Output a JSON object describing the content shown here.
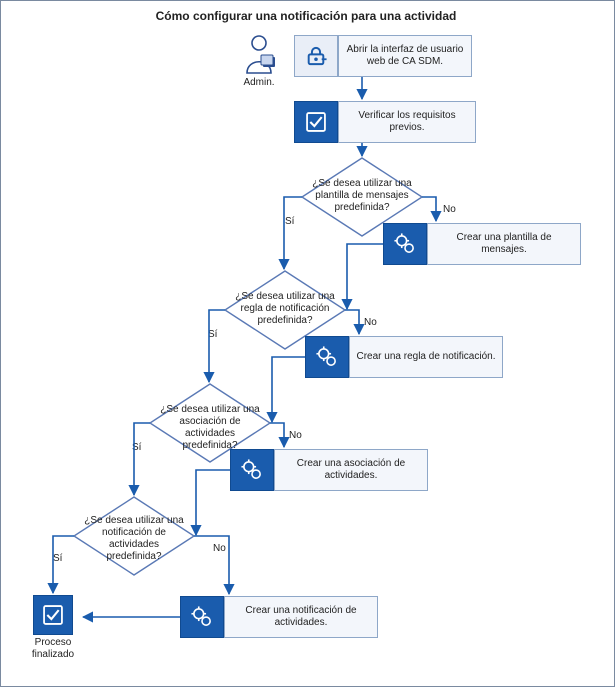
{
  "title": "Cómo configurar una notificación para una actividad",
  "actor": {
    "label": "Admin."
  },
  "steps": {
    "open_ui": "Abrir la interfaz de usuario web de CA SDM.",
    "verify": "Verificar los requisitos previos.",
    "create_template": "Crear una plantilla de mensajes.",
    "create_rule": "Crear una regla de notificación.",
    "create_assoc": "Crear una asociación de actividades.",
    "create_notif": "Crear una notificación de actividades."
  },
  "decisions": {
    "d1": "¿Se desea utilizar una plantilla de mensajes predefinida?",
    "d2": "¿Se desea utilizar una regla de notificación predefinida?",
    "d3": "¿Se desea utilizar una asociación de actividades predefinida?",
    "d4": "¿Se desea utilizar una notificación de actividades predefinida?"
  },
  "labels": {
    "yes": "Sí",
    "no": "No"
  },
  "end": "Proceso finalizado",
  "colors": {
    "accent": "#1a5cad",
    "border": "#8ea7c8",
    "panel": "#f3f6fb"
  }
}
